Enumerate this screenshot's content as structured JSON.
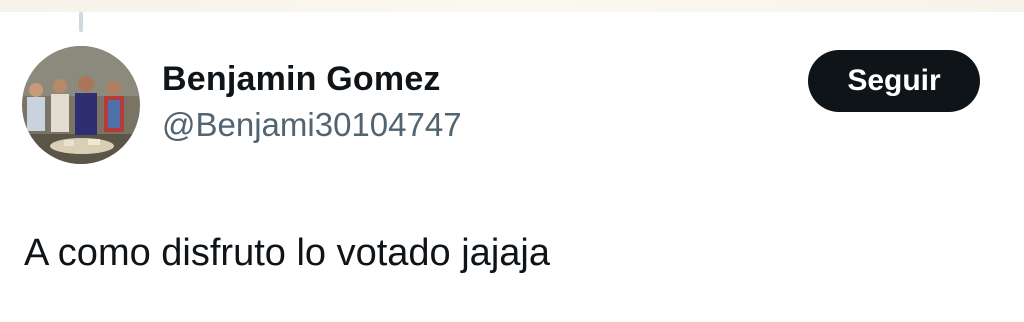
{
  "tweet": {
    "author": {
      "display_name": "Benjamin Gomez",
      "handle": "@Benjami30104747",
      "avatar": "group-photo"
    },
    "follow_button_label": "Seguir",
    "text": "A como disfruto lo votado jajaja"
  },
  "colors": {
    "text_primary": "#0f1419",
    "text_secondary": "#536471",
    "button_bg": "#0f1419",
    "button_text": "#ffffff"
  }
}
